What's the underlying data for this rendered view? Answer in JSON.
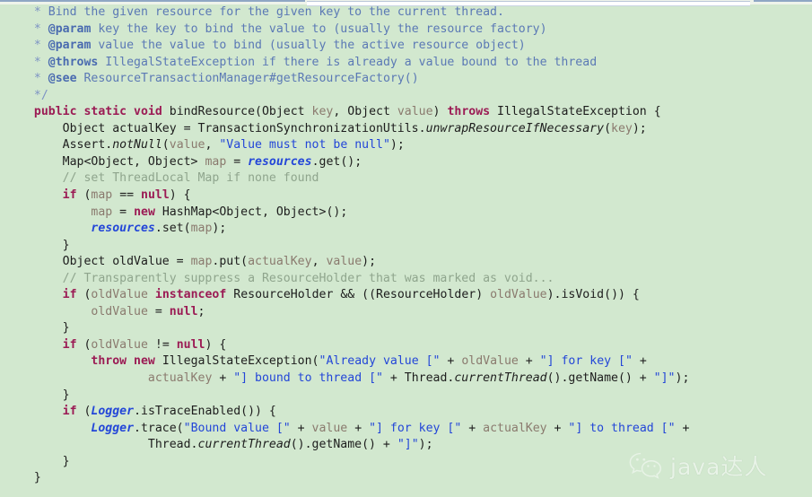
{
  "editor": {
    "background_color": "#d2e8cf",
    "language": "java",
    "theme_colors": {
      "javadoc": "#5b79b5",
      "javadoc_tag": "#4a6bb0",
      "line_comment": "#8fa58d",
      "keyword": "#9b1b54",
      "string": "#2346d8",
      "identifier": "#1d1d1d",
      "parameter": "#8a7a6e",
      "static_field": "#2346d8",
      "static_method": "#1d1d1d"
    }
  },
  "code": {
    "lines": [
      {
        "indent": "  ",
        "tokens": [
          {
            "t": "docstar",
            "s": "* "
          },
          {
            "t": "doc",
            "s": "Bind the given resource for the given key to the current thread."
          }
        ]
      },
      {
        "indent": "  ",
        "tokens": [
          {
            "t": "docstar",
            "s": "* "
          },
          {
            "t": "doctag",
            "s": "@param"
          },
          {
            "t": "doc",
            "s": " key the key to bind the value to (usually the resource factory)"
          }
        ]
      },
      {
        "indent": "  ",
        "tokens": [
          {
            "t": "docstar",
            "s": "* "
          },
          {
            "t": "doctag",
            "s": "@param"
          },
          {
            "t": "doc",
            "s": " value the value to bind (usually the active resource object)"
          }
        ]
      },
      {
        "indent": "  ",
        "tokens": [
          {
            "t": "docstar",
            "s": "* "
          },
          {
            "t": "doctag",
            "s": "@throws"
          },
          {
            "t": "doc",
            "s": " IllegalStateException if there is already a value bound to the thread"
          }
        ]
      },
      {
        "indent": "  ",
        "tokens": [
          {
            "t": "docstar",
            "s": "* "
          },
          {
            "t": "doctag",
            "s": "@see"
          },
          {
            "t": "doc",
            "s": " ResourceTransactionManager#getResourceFactory()"
          }
        ]
      },
      {
        "indent": "  ",
        "tokens": [
          {
            "t": "docstar",
            "s": "*/"
          }
        ]
      },
      {
        "indent": "  ",
        "tokens": [
          {
            "t": "kw",
            "s": "public static void"
          },
          {
            "t": "plain",
            "s": " bindResource(Object "
          },
          {
            "t": "param",
            "s": "key"
          },
          {
            "t": "plain",
            "s": ", Object "
          },
          {
            "t": "param",
            "s": "value"
          },
          {
            "t": "plain",
            "s": ") "
          },
          {
            "t": "kw",
            "s": "throws"
          },
          {
            "t": "plain",
            "s": " IllegalStateException {"
          }
        ]
      },
      {
        "indent": "      ",
        "tokens": [
          {
            "t": "plain",
            "s": "Object actualKey = TransactionSynchronizationUtils."
          },
          {
            "t": "statm",
            "s": "unwrapResourceIfNecessary"
          },
          {
            "t": "plain",
            "s": "("
          },
          {
            "t": "param",
            "s": "key"
          },
          {
            "t": "plain",
            "s": ");"
          }
        ]
      },
      {
        "indent": "      ",
        "tokens": [
          {
            "t": "plain",
            "s": "Assert."
          },
          {
            "t": "statm",
            "s": "notNull"
          },
          {
            "t": "plain",
            "s": "("
          },
          {
            "t": "param",
            "s": "value"
          },
          {
            "t": "plain",
            "s": ", "
          },
          {
            "t": "str",
            "s": "\"Value must not be null\""
          },
          {
            "t": "plain",
            "s": ");"
          }
        ]
      },
      {
        "indent": "      ",
        "tokens": [
          {
            "t": "plain",
            "s": "Map<Object, Object> "
          },
          {
            "t": "param",
            "s": "map"
          },
          {
            "t": "plain",
            "s": " = "
          },
          {
            "t": "field",
            "s": "resources"
          },
          {
            "t": "plain",
            "s": ".get();"
          }
        ]
      },
      {
        "indent": "      ",
        "tokens": [
          {
            "t": "cmt",
            "s": "// set ThreadLocal Map if none found"
          }
        ]
      },
      {
        "indent": "      ",
        "tokens": [
          {
            "t": "kw",
            "s": "if"
          },
          {
            "t": "plain",
            "s": " ("
          },
          {
            "t": "param",
            "s": "map"
          },
          {
            "t": "plain",
            "s": " == "
          },
          {
            "t": "kw",
            "s": "null"
          },
          {
            "t": "plain",
            "s": ") {"
          }
        ]
      },
      {
        "indent": "          ",
        "tokens": [
          {
            "t": "param",
            "s": "map"
          },
          {
            "t": "plain",
            "s": " = "
          },
          {
            "t": "kw",
            "s": "new"
          },
          {
            "t": "plain",
            "s": " HashMap<Object, Object>();"
          }
        ]
      },
      {
        "indent": "          ",
        "tokens": [
          {
            "t": "field",
            "s": "resources"
          },
          {
            "t": "plain",
            "s": ".set("
          },
          {
            "t": "param",
            "s": "map"
          },
          {
            "t": "plain",
            "s": ");"
          }
        ]
      },
      {
        "indent": "      ",
        "tokens": [
          {
            "t": "plain",
            "s": "}"
          }
        ]
      },
      {
        "indent": "      ",
        "tokens": [
          {
            "t": "plain",
            "s": "Object oldValue = "
          },
          {
            "t": "param",
            "s": "map"
          },
          {
            "t": "plain",
            "s": ".put("
          },
          {
            "t": "param",
            "s": "actualKey"
          },
          {
            "t": "plain",
            "s": ", "
          },
          {
            "t": "param",
            "s": "value"
          },
          {
            "t": "plain",
            "s": ");"
          }
        ]
      },
      {
        "indent": "      ",
        "tokens": [
          {
            "t": "cmt",
            "s": "// Transparently suppress a ResourceHolder that was marked as void..."
          }
        ]
      },
      {
        "indent": "      ",
        "tokens": [
          {
            "t": "kw",
            "s": "if"
          },
          {
            "t": "plain",
            "s": " ("
          },
          {
            "t": "param",
            "s": "oldValue"
          },
          {
            "t": "plain",
            "s": " "
          },
          {
            "t": "kw",
            "s": "instanceof"
          },
          {
            "t": "plain",
            "s": " ResourceHolder && ((ResourceHolder) "
          },
          {
            "t": "param",
            "s": "oldValue"
          },
          {
            "t": "plain",
            "s": ").isVoid()) {"
          }
        ]
      },
      {
        "indent": "          ",
        "tokens": [
          {
            "t": "param",
            "s": "oldValue"
          },
          {
            "t": "plain",
            "s": " = "
          },
          {
            "t": "kw",
            "s": "null"
          },
          {
            "t": "plain",
            "s": ";"
          }
        ]
      },
      {
        "indent": "      ",
        "tokens": [
          {
            "t": "plain",
            "s": "}"
          }
        ]
      },
      {
        "indent": "      ",
        "tokens": [
          {
            "t": "kw",
            "s": "if"
          },
          {
            "t": "plain",
            "s": " ("
          },
          {
            "t": "param",
            "s": "oldValue"
          },
          {
            "t": "plain",
            "s": " != "
          },
          {
            "t": "kw",
            "s": "null"
          },
          {
            "t": "plain",
            "s": ") {"
          }
        ]
      },
      {
        "indent": "          ",
        "tokens": [
          {
            "t": "kw",
            "s": "throw new"
          },
          {
            "t": "plain",
            "s": " IllegalStateException("
          },
          {
            "t": "str",
            "s": "\"Already value [\""
          },
          {
            "t": "plain",
            "s": " + "
          },
          {
            "t": "param",
            "s": "oldValue"
          },
          {
            "t": "plain",
            "s": " + "
          },
          {
            "t": "str",
            "s": "\"] for key [\""
          },
          {
            "t": "plain",
            "s": " +"
          }
        ]
      },
      {
        "indent": "                  ",
        "tokens": [
          {
            "t": "param",
            "s": "actualKey"
          },
          {
            "t": "plain",
            "s": " + "
          },
          {
            "t": "str",
            "s": "\"] bound to thread [\""
          },
          {
            "t": "plain",
            "s": " + Thread."
          },
          {
            "t": "statm",
            "s": "currentThread"
          },
          {
            "t": "plain",
            "s": "().getName() + "
          },
          {
            "t": "str",
            "s": "\"]\""
          },
          {
            "t": "plain",
            "s": ");"
          }
        ]
      },
      {
        "indent": "      ",
        "tokens": [
          {
            "t": "plain",
            "s": "}"
          }
        ]
      },
      {
        "indent": "      ",
        "tokens": [
          {
            "t": "kw",
            "s": "if"
          },
          {
            "t": "plain",
            "s": " ("
          },
          {
            "t": "field",
            "s": "Logger"
          },
          {
            "t": "plain",
            "s": ".isTraceEnabled()) {"
          }
        ]
      },
      {
        "indent": "          ",
        "tokens": [
          {
            "t": "field",
            "s": "Logger"
          },
          {
            "t": "plain",
            "s": ".trace("
          },
          {
            "t": "str",
            "s": "\"Bound value [\""
          },
          {
            "t": "plain",
            "s": " + "
          },
          {
            "t": "param",
            "s": "value"
          },
          {
            "t": "plain",
            "s": " + "
          },
          {
            "t": "str",
            "s": "\"] for key [\""
          },
          {
            "t": "plain",
            "s": " + "
          },
          {
            "t": "param",
            "s": "actualKey"
          },
          {
            "t": "plain",
            "s": " + "
          },
          {
            "t": "str",
            "s": "\"] to thread [\""
          },
          {
            "t": "plain",
            "s": " +"
          }
        ]
      },
      {
        "indent": "                  ",
        "tokens": [
          {
            "t": "plain",
            "s": "Thread."
          },
          {
            "t": "statm",
            "s": "currentThread"
          },
          {
            "t": "plain",
            "s": "().getName() + "
          },
          {
            "t": "str",
            "s": "\"]\""
          },
          {
            "t": "plain",
            "s": ");"
          }
        ]
      },
      {
        "indent": "      ",
        "tokens": [
          {
            "t": "plain",
            "s": "}"
          }
        ]
      },
      {
        "indent": "  ",
        "tokens": [
          {
            "t": "plain",
            "s": "}"
          }
        ]
      }
    ]
  },
  "watermark": {
    "icon": "wechat-icon",
    "text": "java达人"
  }
}
